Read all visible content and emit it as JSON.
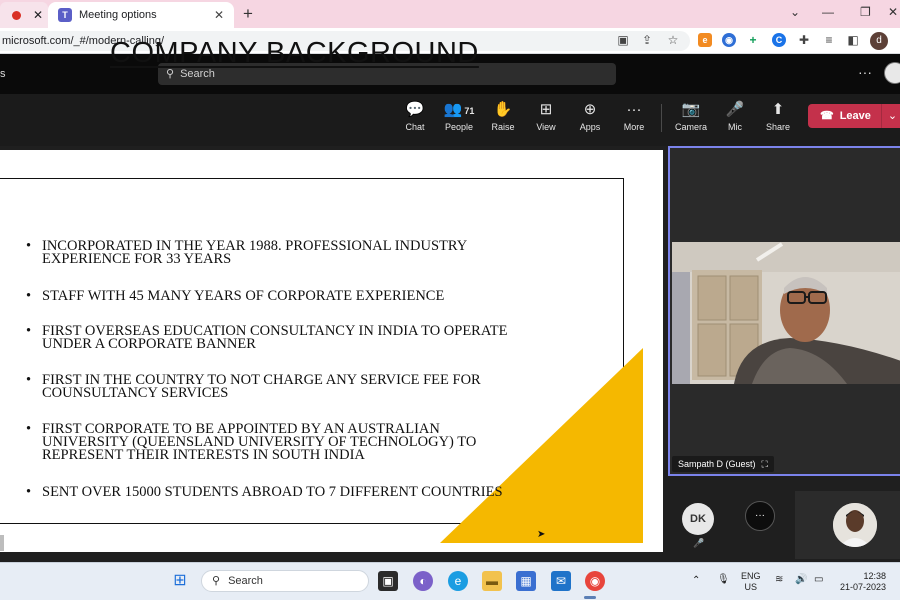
{
  "browser": {
    "tabs": [
      {
        "label": "",
        "recording": true
      },
      {
        "label": "Meeting options"
      }
    ],
    "new_tab_icon": "+",
    "url": "microsoft.com/_#/modern-calling/",
    "profile_letter": "d",
    "window_controls": {
      "minimize": "—",
      "restore": "❐",
      "close": "✕",
      "tab_list": "⌄"
    }
  },
  "teams_header": {
    "app_letter": "s",
    "search_placeholder": "Search",
    "more_icon": "···"
  },
  "meeting_toolbar": {
    "people_count": "71",
    "tools": [
      {
        "name": "chat",
        "label": "Chat",
        "icon": "💬"
      },
      {
        "name": "people",
        "label": "People",
        "icon": "👥"
      },
      {
        "name": "raise",
        "label": "Raise",
        "icon": "✋"
      },
      {
        "name": "view",
        "label": "View",
        "icon": "⊞"
      },
      {
        "name": "apps",
        "label": "Apps",
        "icon": "⊕"
      },
      {
        "name": "more",
        "label": "More",
        "icon": "···"
      },
      {
        "name": "camera",
        "label": "Camera",
        "icon": "📷"
      },
      {
        "name": "mic",
        "label": "Mic",
        "icon": "🎤"
      },
      {
        "name": "share",
        "label": "Share",
        "icon": "⬆"
      }
    ],
    "leave_label": "Leave",
    "leave_color": "#c4314b"
  },
  "slide": {
    "title": "COMPANY BACKGROUND",
    "bullets": [
      "INCORPORATED IN THE YEAR 1988. PROFESSIONAL INDUSTRY EXPERIENCE FOR 33 YEARS",
      "STAFF WITH 45 MANY YEARS OF CORPORATE EXPERIENCE",
      "FIRST OVERSEAS EDUCATION CONSULTANCY IN INDIA TO OPERATE UNDER A CORPORATE BANNER",
      "FIRST IN THE COUNTRY TO NOT CHARGE ANY SERVICE FEE FOR COUNSULTANCY SERVICES",
      "FIRST CORPORATE TO BE APPOINTED BY AN AUSTRALIAN UNIVERSITY (QUEENSLAND UNIVERSITY OF TECHNOLOGY) TO REPRESENT THEIR INTERESTS IN SOUTH INDIA",
      "SENT OVER 15000 STUDENTS ABROAD TO 7 DIFFERENT COUNTRIES"
    ],
    "accent_color": "#f5b800"
  },
  "participants": {
    "main_speaker": "Sampath D (Guest)",
    "others_initials": "DK",
    "more_label": "···"
  },
  "taskbar": {
    "search_placeholder": "Search",
    "language": "ENG",
    "region": "US",
    "time": "12:38",
    "date": "21-07-2023"
  }
}
